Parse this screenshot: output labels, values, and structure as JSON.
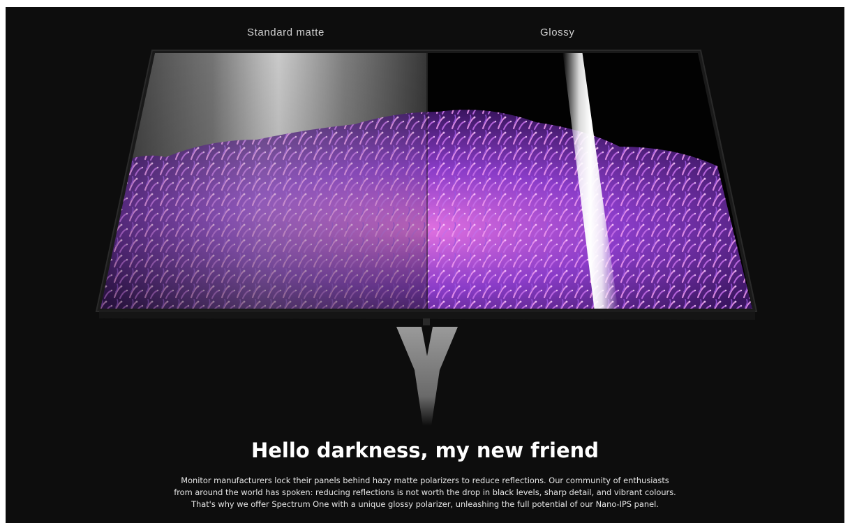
{
  "comparison": {
    "left_label": "Standard matte",
    "right_label": "Glossy"
  },
  "colors": {
    "background": "#0d0d0d",
    "accent_purple": "#a24be0",
    "accent_pink": "#e05ad8",
    "text": "#ffffff"
  },
  "section": {
    "headline": "Hello darkness, my new friend",
    "body_lines": [
      "Monitor manufacturers lock their panels behind hazy matte polarizers to reduce reflections. Our community of enthusiasts",
      "from around the world has spoken: reducing reflections is not worth the drop in black levels, sharp detail, and vibrant colours.",
      "That's why we offer Spectrum One with a unique glossy polarizer, unleashing the full potential of our Nano-IPS panel."
    ]
  }
}
